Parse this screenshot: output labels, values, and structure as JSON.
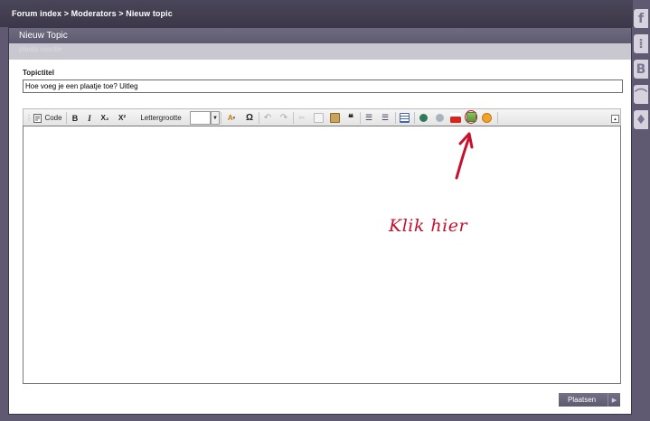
{
  "breadcrumb": "Forum index > Moderators > Nieuw topic",
  "panel": {
    "title": "Nieuw Topic",
    "subtitle": "plaats reactie"
  },
  "form": {
    "title_label": "Topictitel",
    "title_value": "Hoe voeg je een plaatje toe? Uitleg"
  },
  "toolbar": {
    "code_label": "Code",
    "bold_label": "B",
    "italic_label": "I",
    "subscript_label": "X₂",
    "superscript_label": "X²",
    "fontsize_label": "Lettergrootte",
    "fontsize_value": "",
    "quote_label": "❝",
    "textcolor_label": "A",
    "specialchar_label": "Ω"
  },
  "annotation": "Klik hier",
  "submit": {
    "label": "Plaatsen",
    "arrow": "▶"
  },
  "social": {
    "facebook": "f",
    "item2": "⁞",
    "item3": "B",
    "rss": "⌒",
    "item5": "♦"
  },
  "colors": {
    "accent_red": "#c8102e",
    "header_bg": "#3c3849",
    "panel_head": "#6e6a80"
  }
}
